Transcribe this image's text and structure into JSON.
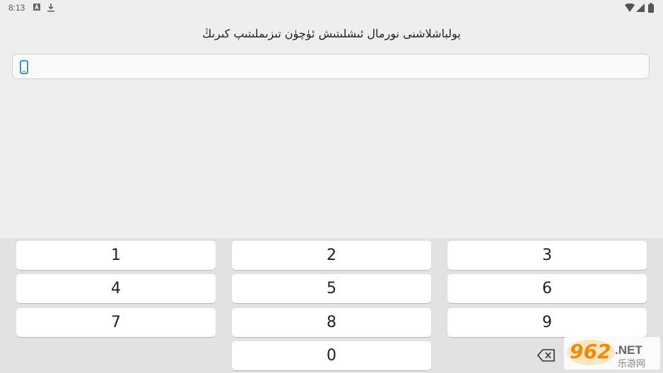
{
  "status_bar": {
    "time": "8:13",
    "icons": [
      "a-notification-icon",
      "download-icon",
      "wifi-icon",
      "cellular-icon",
      "battery-icon"
    ]
  },
  "title": "يولباشلاشنى نورمال ئىشلىتىش ئۈچۈن تىزىملىتىپ كىرىڭ",
  "phone_input": {
    "icon": "phone-icon",
    "value": "",
    "placeholder": ""
  },
  "keypad": {
    "keys": [
      "1",
      "2",
      "3",
      "4",
      "5",
      "6",
      "7",
      "8",
      "9",
      "0"
    ],
    "backspace_icon": "backspace-icon"
  },
  "watermark": {
    "brand": "962",
    "suffix": ".NET",
    "subtitle": "乐游网"
  },
  "colors": {
    "background": "#eeeeee",
    "keypad_background": "#e2e2e4",
    "accent": "#1e88e5"
  }
}
